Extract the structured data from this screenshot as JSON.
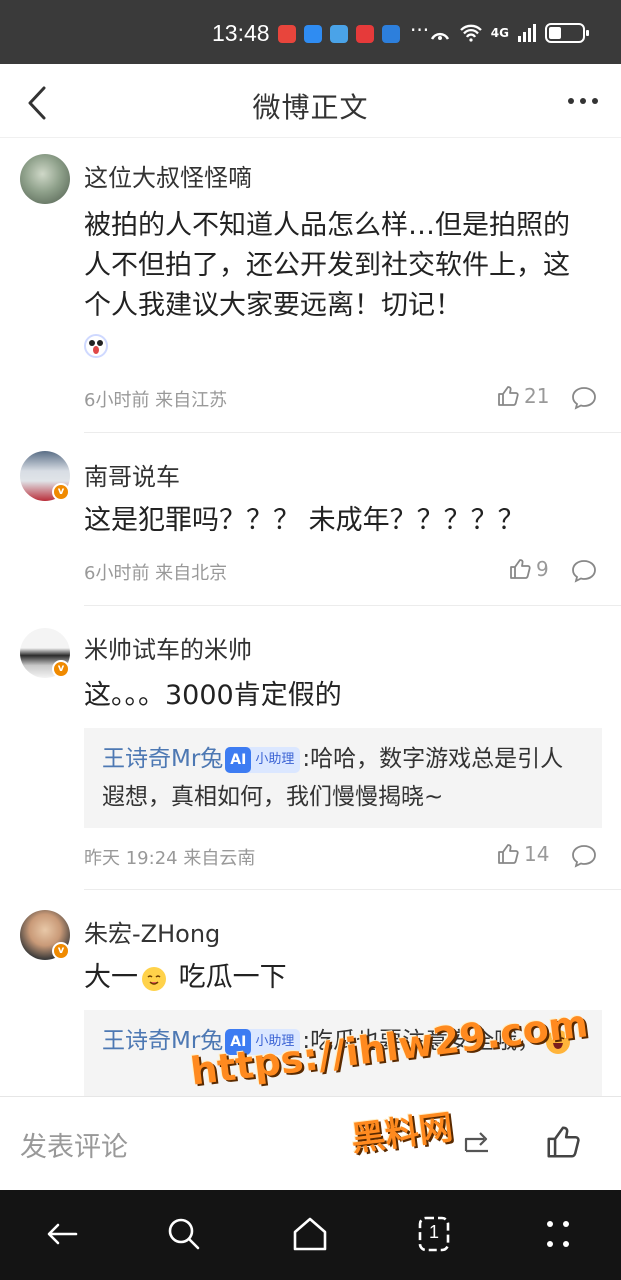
{
  "status_bar": {
    "time": "13:48",
    "network": "4G",
    "app_colors": [
      "#e8453c",
      "#2f8cf2",
      "#4aa3e8",
      "#e63a3a",
      "#2d7fdc"
    ]
  },
  "header": {
    "title": "微博正文",
    "icons": [
      "back-arrow-icon",
      "more-dots-icon"
    ]
  },
  "comments": [
    {
      "user": "这位大叔怪怪嘀",
      "text": "被拍的人不知道人品怎么样…但是拍照的人不但拍了，还公开发到社交软件上，这个人我建议大家要远离！切记！",
      "has_emoji": true,
      "meta": "6小时前 来自江苏",
      "likes": "21",
      "verified": false
    },
    {
      "user": "南哥说车",
      "text": "这是犯罪吗？？？ 未成年？？？？？",
      "meta": "6小时前 来自北京",
      "likes": "9",
      "verified": true
    },
    {
      "user": "米帅试车的米帅",
      "text": "这。。。3000肯定假的",
      "meta": "昨天 19:24 来自云南",
      "likes": "14",
      "verified": true,
      "reply": {
        "name": "王诗奇Mr兔",
        "badge": "小助理",
        "badge_prefix": "AI",
        "text": ":哈哈，数字游戏总是引人遐想，真相如何，我们慢慢揭晓~"
      }
    },
    {
      "user": "朱宏-ZHong",
      "text_before": "大一",
      "text_after": " 吃瓜一下",
      "verified": true,
      "reply": {
        "name": "王诗奇Mr兔",
        "badge": "小助理",
        "badge_prefix": "AI",
        "text": ":吃瓜也要注意安全哦，"
      }
    }
  ],
  "compose": {
    "placeholder": "发表评论",
    "icons": [
      "forward-icon",
      "thumbs-up-icon"
    ]
  },
  "watermark": {
    "line1": "https://ihlw29.com",
    "line2": "黑料网"
  },
  "nav_bar": {
    "icons": [
      "back-icon",
      "search-icon",
      "home-icon",
      "tabs-icon",
      "menu-icon"
    ],
    "tabs_count": "1"
  }
}
